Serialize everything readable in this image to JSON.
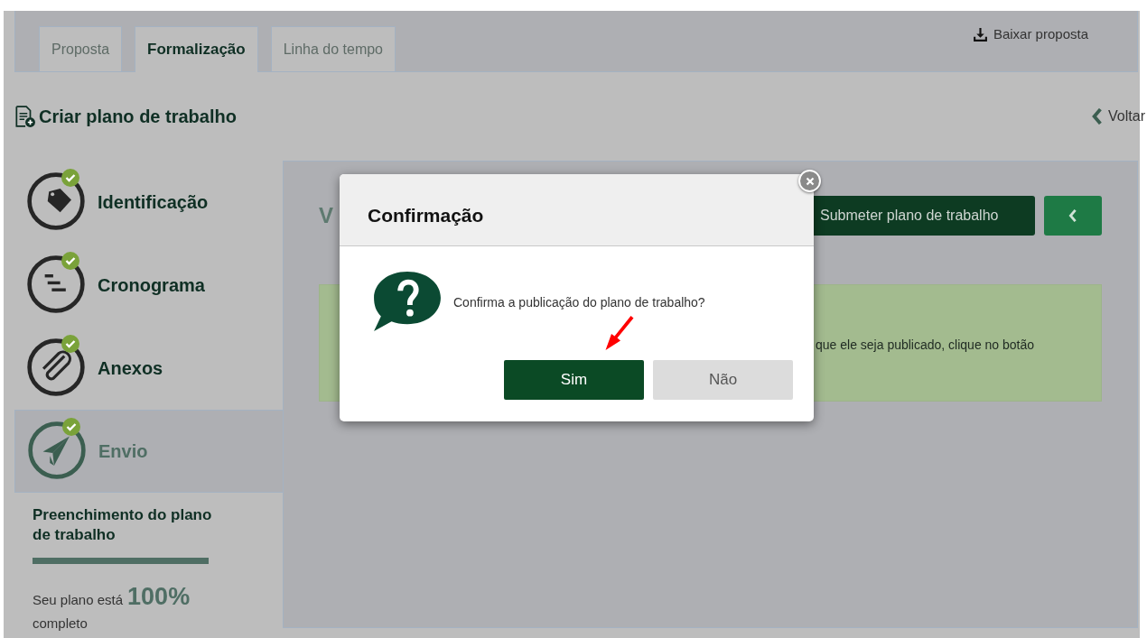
{
  "tabs": [
    {
      "label": "Proposta",
      "selected": false
    },
    {
      "label": "Formalização",
      "selected": true
    },
    {
      "label": "Linha do tempo",
      "selected": false
    }
  ],
  "download_link": "Baixar proposta",
  "page_title": "Criar plano de trabalho",
  "back_link": "Voltar",
  "steps": [
    {
      "label": "Identificação",
      "kind": "tag",
      "done": true,
      "selected": false
    },
    {
      "label": "Cronograma",
      "kind": "schedule",
      "done": true,
      "selected": false
    },
    {
      "label": "Anexos",
      "kind": "clip",
      "done": true,
      "selected": false
    },
    {
      "label": "Envio",
      "kind": "send",
      "done": true,
      "selected": true
    }
  ],
  "progress": {
    "title": "Preenchimento do plano de trabalho",
    "level": 1,
    "caption": "Seu plano está",
    "percent": "100%",
    "caption_end": "completo"
  },
  "content": {
    "heading": "V",
    "submit_button": "Submeter plano de trabalho",
    "alert_text": "que ele seja publicado, clique no botão"
  },
  "dialog": {
    "title": "Confirmação",
    "message": "Confirma a publicação do plano de trabalho?",
    "buttons": [
      {
        "label": "Sim",
        "kind": "primary"
      },
      {
        "label": "Não",
        "kind": "secondary"
      }
    ]
  }
}
